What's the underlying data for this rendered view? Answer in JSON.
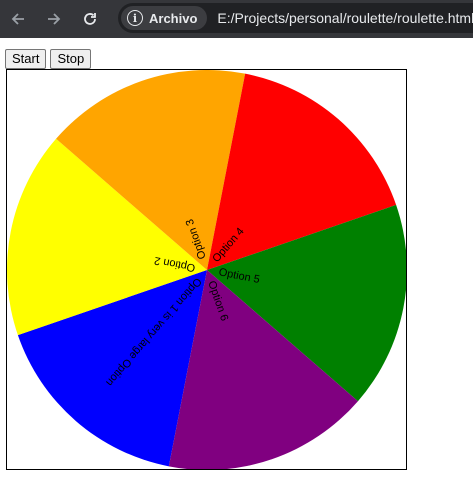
{
  "browser": {
    "back_icon": "arrow-left-icon",
    "forward_icon": "arrow-right-icon",
    "reload_icon": "reload-icon",
    "site_info_icon": "info-icon",
    "site_label": "Archivo",
    "url": "E:/Projects/personal/roulette/roulette.html"
  },
  "controls": {
    "start_label": "Start",
    "stop_label": "Stop"
  },
  "wheel": {
    "segments": [
      {
        "label": "Option 1 is very large Option",
        "color": "#0000ff"
      },
      {
        "label": "Option 2",
        "color": "#ffff00"
      },
      {
        "label": "Option 3",
        "color": "#ffa500"
      },
      {
        "label": "Option 4",
        "color": "#ff0000"
      },
      {
        "label": "Option 5",
        "color": "#008000"
      },
      {
        "label": "Option 6",
        "color": "#800080"
      }
    ]
  }
}
